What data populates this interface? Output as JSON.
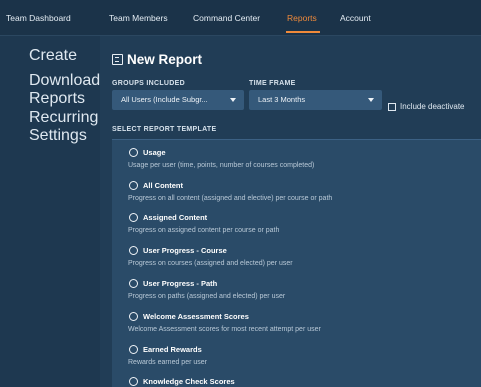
{
  "nav": {
    "tabs": [
      {
        "label": "Team Dashboard"
      },
      {
        "label": "Team Members"
      },
      {
        "label": "Command Center"
      },
      {
        "label": "Reports"
      },
      {
        "label": "Account"
      }
    ],
    "active_tab": "Reports",
    "accent_color": "#f08a3a"
  },
  "sidebar": {
    "items": [
      {
        "label": "Create"
      },
      {
        "label": "Downloaded Reports"
      },
      {
        "label": "Recurring Settings"
      }
    ]
  },
  "page": {
    "title": "New Report",
    "title_icon": "report-icon"
  },
  "filters": {
    "groups_label": "GROUPS INCLUDED",
    "groups_value": "All Users (Include Subgr...",
    "timeframe_label": "TIME FRAME",
    "timeframe_value": "Last 3 Months",
    "include_deactivated_label": "Include deactivate",
    "include_deactivated_checked": false
  },
  "templates": {
    "label": "SELECT REPORT TEMPLATE",
    "options": [
      {
        "title": "Usage",
        "desc": "Usage per user (time, points, number of courses completed)"
      },
      {
        "title": "All Content",
        "desc": "Progress on all content (assigned and elective) per course or path"
      },
      {
        "title": "Assigned Content",
        "desc": "Progress on assigned content per course or path"
      },
      {
        "title": "User Progress - Course",
        "desc": "Progress on courses (assigned and elected) per user"
      },
      {
        "title": "User Progress - Path",
        "desc": "Progress on paths (assigned and elected) per user"
      },
      {
        "title": "Welcome Assessment Scores",
        "desc": "Welcome Assessment scores for most recent attempt per user"
      },
      {
        "title": "Earned Rewards",
        "desc": "Rewards earned per user"
      },
      {
        "title": "Knowledge Check Scores",
        "desc": ""
      }
    ]
  }
}
